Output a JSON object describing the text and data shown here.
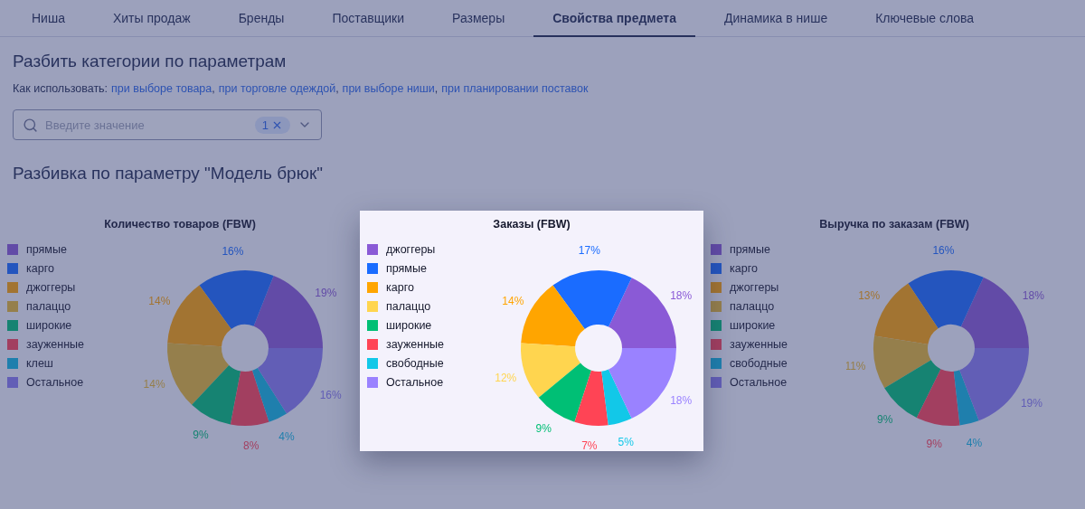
{
  "tabs": [
    {
      "label": "Ниша",
      "selected": false
    },
    {
      "label": "Хиты продаж",
      "selected": false
    },
    {
      "label": "Бренды",
      "selected": false
    },
    {
      "label": "Поставщики",
      "selected": false
    },
    {
      "label": "Размеры",
      "selected": false
    },
    {
      "label": "Свойства предмета",
      "selected": true
    },
    {
      "label": "Динамика в нише",
      "selected": false
    },
    {
      "label": "Ключевые слова",
      "selected": false
    }
  ],
  "heading": "Разбить категории по параметрам",
  "usage": {
    "label": "Как использовать:",
    "separator": ",",
    "links": [
      "при выборе товара",
      "при торговле одеждой",
      "при выборе ниши",
      "при планировании поставок"
    ]
  },
  "search": {
    "placeholder": "Введите значение",
    "count": "1"
  },
  "section_title": "Разбивка по параметру \"Модель брюк\"",
  "charts": [
    {
      "highlighted": false,
      "chart_data": {
        "type": "donut",
        "title": "Количество товаров (FBW)",
        "categories": [
          "прямые",
          "карго",
          "джоггеры",
          "палаццо",
          "широкие",
          "зауженные",
          "клеш",
          "Остальное"
        ],
        "values": [
          19,
          16,
          14,
          14,
          9,
          8,
          4,
          16
        ],
        "value_labels": [
          "19%",
          "16%",
          "14%",
          "14%",
          "9%",
          "8%",
          "4%",
          "16%"
        ],
        "colors": [
          "#8a5ad6",
          "#1a6cff",
          "#ffa500",
          "#e8b830",
          "#00bf75",
          "#ff4455",
          "#12b8e0",
          "#8a7cf0"
        ]
      }
    },
    {
      "highlighted": true,
      "chart_data": {
        "type": "donut",
        "title": "Заказы (FBW)",
        "categories": [
          "джоггеры",
          "прямые",
          "карго",
          "палаццо",
          "широкие",
          "зауженные",
          "свободные",
          "Остальное"
        ],
        "values": [
          18,
          17,
          14,
          12,
          9,
          7,
          5,
          18
        ],
        "value_labels": [
          "18%",
          "17%",
          "14%",
          "12%",
          "9%",
          "7%",
          "5%",
          "18%"
        ],
        "colors": [
          "#8a5ad6",
          "#1a6cff",
          "#ffa500",
          "#ffd54f",
          "#00bf75",
          "#ff4455",
          "#12c8e8",
          "#9a82ff"
        ]
      }
    },
    {
      "highlighted": false,
      "chart_data": {
        "type": "donut",
        "title": "Выручка по заказам (FBW)",
        "categories": [
          "прямые",
          "карго",
          "джоггеры",
          "палаццо",
          "широкие",
          "зауженные",
          "свободные",
          "Остальное"
        ],
        "values": [
          18,
          16,
          13,
          11,
          9,
          9,
          4,
          19
        ],
        "value_labels": [
          "18%",
          "16%",
          "13%",
          "11%",
          "9%",
          "9%",
          "4%",
          "19%"
        ],
        "colors": [
          "#8a5ad6",
          "#1a6cff",
          "#ffa500",
          "#e8b830",
          "#00bf75",
          "#ff4455",
          "#12b8e0",
          "#8a7cf0"
        ]
      }
    }
  ]
}
